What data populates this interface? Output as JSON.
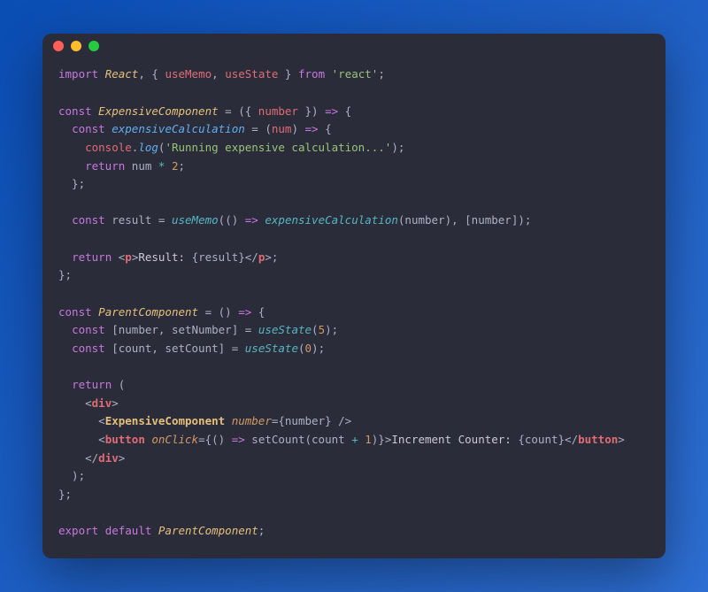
{
  "window": {
    "trafficLights": [
      "close",
      "minimize",
      "maximize"
    ]
  },
  "code": {
    "line1": {
      "import": "import",
      "react": "React",
      "comma1": ", {",
      "useMemo": "useMemo",
      "comma2": ", ",
      "useState": "useState",
      "brace": " }",
      "from": "from",
      "reactStr": "'react'",
      "semi": ";"
    },
    "line3": {
      "const": "const",
      "ExpensiveComponent": "ExpensiveComponent",
      "eq": " = ",
      "paren1": "({ ",
      "number": "number",
      "paren2": " }) ",
      "arrow": "=>",
      "brace": " {"
    },
    "line4": {
      "const": "const",
      "expensiveCalculation": "expensiveCalculation",
      "eq": " = ",
      "paren": "(",
      "num": "num",
      "paren2": ") ",
      "arrow": "=>",
      "brace": " {"
    },
    "line5": {
      "console": "console",
      "dot": ".",
      "log": "log",
      "paren": "(",
      "str": "'Running expensive calculation...'",
      "close": ");"
    },
    "line6": {
      "return": "return",
      "num": " num ",
      "op": "*",
      "two": " 2",
      "semi": ";"
    },
    "line7": {
      "close": "  };"
    },
    "line9": {
      "const": "const",
      "result": " result ",
      "eq": "= ",
      "useMemo": "useMemo",
      "paren": "(() ",
      "arrow": "=>",
      "sp": " ",
      "expCalc": "expensiveCalculation",
      "p2": "(number), [number]);"
    },
    "line11": {
      "return": "return",
      "open": " <",
      "p": "p",
      "gt": ">",
      "txt": "Result: ",
      "brace1": "{result}",
      "close": "</",
      "p2": "p",
      "gt2": ">;"
    },
    "line12": {
      "close": "};"
    },
    "line14": {
      "const": "const",
      "ParentComponent": "ParentComponent",
      "eq": " = () ",
      "arrow": "=>",
      "brace": " {"
    },
    "line15": {
      "const": "const",
      "destruct": " [number, setNumber] ",
      "eq": "= ",
      "useState": "useState",
      "paren": "(",
      "five": "5",
      "close": ");"
    },
    "line16": {
      "const": "const",
      "destruct": " [count, setCount] ",
      "eq": "= ",
      "useState": "useState",
      "paren": "(",
      "zero": "0",
      "close": ");"
    },
    "line18": {
      "return": "return",
      "paren": " ("
    },
    "line19": {
      "open": "<",
      "div": "div",
      "gt": ">"
    },
    "line20": {
      "open": "<",
      "comp": "ExpensiveComponent",
      "sp": " ",
      "attr": "number",
      "eq": "=",
      "val": "{number}",
      "close": " />"
    },
    "line21": {
      "open": "<",
      "button": "button",
      "sp": " ",
      "onClick": "onClick",
      "eq": "=",
      "brace": "{() ",
      "arrow": "=>",
      "call": " setCount(count ",
      "plus": "+",
      "one": " 1",
      "close": ")}>",
      "txt": "Increment Counter: ",
      "count": "{count}",
      "closeTag": "</",
      "button2": "button",
      "gt": ">"
    },
    "line22": {
      "close": "</",
      "div": "div",
      "gt": ">"
    },
    "line23": {
      "close": "  );"
    },
    "line24": {
      "close": "};"
    },
    "line26": {
      "export": "export",
      "default": "default",
      "ParentComponent": "ParentComponent",
      "semi": ";"
    }
  }
}
